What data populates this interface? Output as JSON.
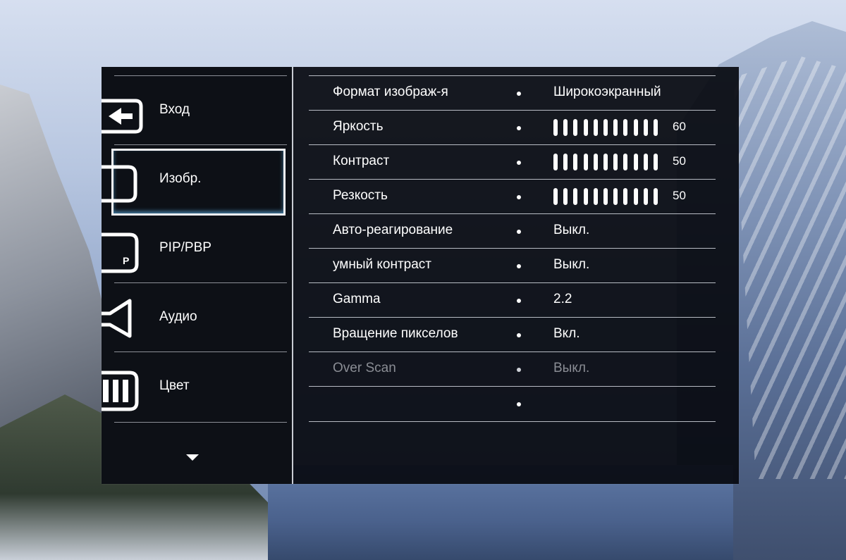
{
  "sidebar": {
    "items": [
      {
        "label": "Вход",
        "icon": "input-source-icon"
      },
      {
        "label": "Изобр.",
        "icon": "picture-icon",
        "selected": true
      },
      {
        "label": "PIP/PBP",
        "icon": "pip-icon"
      },
      {
        "label": "Аудио",
        "icon": "speaker-icon"
      },
      {
        "label": "Цвет",
        "icon": "color-icon"
      }
    ],
    "more_icon": "chevron-down-icon"
  },
  "settings": [
    {
      "name": "Формат изображ-я",
      "value": "Широкоэкранный"
    },
    {
      "name": "Яркость",
      "level": 60,
      "value": "60"
    },
    {
      "name": "Контраст",
      "level": 50,
      "value": "50"
    },
    {
      "name": "Резкость",
      "level": 50,
      "value": "50"
    },
    {
      "name": "Авто-реагирование",
      "value": "Выкл."
    },
    {
      "name": "умный контраст",
      "value": "Выкл."
    },
    {
      "name": "Gamma",
      "value": "2.2"
    },
    {
      "name": "Вращение пикселов",
      "value": "Вкл."
    },
    {
      "name": "Over Scan",
      "value": "Выкл.",
      "disabled": true
    },
    {
      "name": "",
      "value": ""
    }
  ],
  "colors": {
    "panel": "#0d1016",
    "text": "#ffffff",
    "disabled_text": "#8a8d94",
    "selection_glow": "#5aaadc"
  }
}
